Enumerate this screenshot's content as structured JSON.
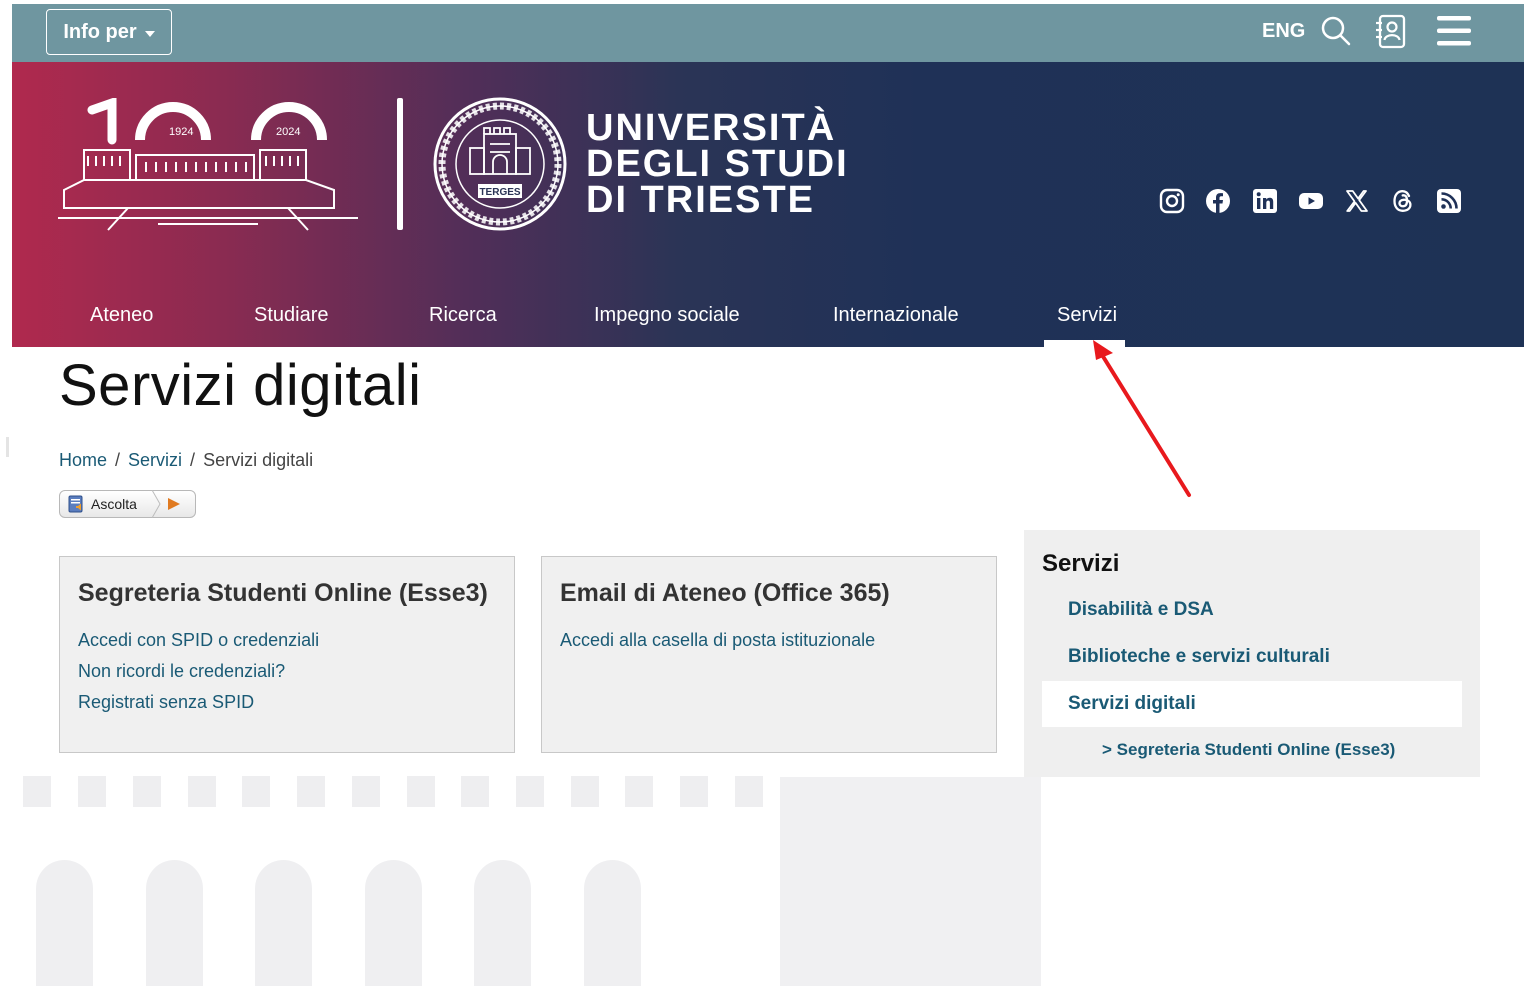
{
  "topbar": {
    "info_label": "Info per",
    "lang_label": "ENG"
  },
  "header": {
    "logo_years": [
      "1924",
      "2024"
    ],
    "university_lines": [
      "UNIVERSITÀ",
      "DEGLI STUDI",
      "DI TRIESTE"
    ],
    "social_icons": [
      "instagram-icon",
      "facebook-icon",
      "linkedin-icon",
      "youtube-icon",
      "x-icon",
      "threads-icon",
      "rss-icon"
    ]
  },
  "nav": {
    "items": [
      "Ateneo",
      "Studiare",
      "Ricerca",
      "Impegno sociale",
      "Internazionale",
      "Servizi"
    ],
    "active": "Servizi"
  },
  "page": {
    "title": "Servizi digitali"
  },
  "breadcrumb": {
    "home": "Home",
    "section": "Servizi",
    "current": "Servizi digitali",
    "separator": "/"
  },
  "listen": {
    "label": "Ascolta"
  },
  "cards": [
    {
      "title": "Segreteria Studenti Online (Esse3)",
      "links": [
        "Accedi con SPID o credenziali",
        "Non ricordi le credenziali?",
        "Registrati senza SPID"
      ]
    },
    {
      "title": "Email di Ateneo (Office 365)",
      "links": [
        "Accedi alla casella di posta istituzionale"
      ]
    }
  ],
  "sidebar": {
    "title": "Servizi",
    "items": [
      "Disabilità e DSA",
      "Biblioteche e servizi culturali",
      "Servizi digitali"
    ],
    "active": "Servizi digitali",
    "subitem": "> Segreteria Studenti Online (Esse3)"
  },
  "colors": {
    "topbar": "#6f96a0",
    "banner_left": "#b0294e",
    "banner_right": "#1e3255",
    "link": "#1a5a75",
    "annotation_arrow": "#e8191d"
  }
}
